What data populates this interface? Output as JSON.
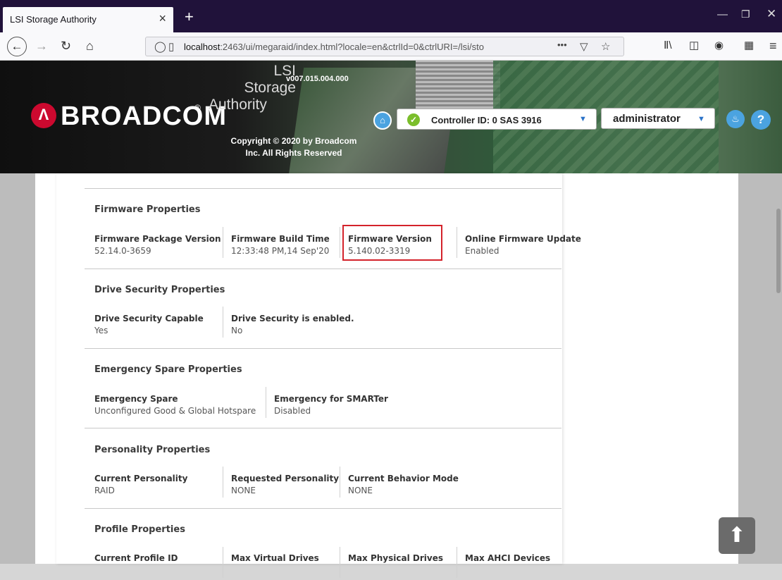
{
  "browser": {
    "tab_title": "LSI Storage Authority",
    "tab_close": "×",
    "new_tab": "+",
    "url_host": "localhost",
    "url_rest": ":2463/ui/megaraid/index.html?locale=en&ctrlId=0&ctrlURI=/lsi/sto",
    "more": "•••"
  },
  "header": {
    "brand": "BROADCOM",
    "brand_mark": "®",
    "app_title_1": "LSI",
    "app_title_2": "Storage",
    "app_title_3": "Authority",
    "version": "v007.015.004.000",
    "copyright": "Copyright © 2020 by Broadcom Inc. All Rights Reserved",
    "controller": "Controller ID: 0 SAS 3916",
    "user": "administrator",
    "help": "?"
  },
  "sections": {
    "firmware": {
      "title": "Firmware Properties",
      "package_label": "Firmware Package Version",
      "package_value": "52.14.0-3659",
      "build_label": "Firmware Build Time",
      "build_value": "12:33:48 PM,14 Sep'20",
      "version_label": "Firmware Version",
      "version_value": "5.140.02-3319",
      "online_label": "Online Firmware Update",
      "online_value": "Enabled"
    },
    "drive_security": {
      "title": "Drive Security Properties",
      "capable_label": "Drive Security Capable",
      "capable_value": "Yes",
      "enabled_label": "Drive Security is enabled.",
      "enabled_value": "No"
    },
    "emergency": {
      "title": "Emergency Spare Properties",
      "spare_label": "Emergency Spare",
      "spare_value": "Unconfigured Good & Global Hotspare",
      "smarter_label": "Emergency for SMARTer",
      "smarter_value": "Disabled"
    },
    "personality": {
      "title": "Personality Properties",
      "current_label": "Current Personality",
      "current_value": "RAID",
      "requested_label": "Requested Personality",
      "requested_value": "NONE",
      "behavior_label": "Current Behavior Mode",
      "behavior_value": "NONE"
    },
    "profile": {
      "title": "Profile Properties",
      "id_label": "Current Profile ID",
      "vd_label": "Max Virtual Drives",
      "pd_label": "Max Physical Drives",
      "ahci_label": "Max AHCI Devices"
    }
  },
  "colors": {
    "highlight": "#d4232b",
    "accent": "#4ba3e0",
    "brand_red": "#cc092f"
  }
}
